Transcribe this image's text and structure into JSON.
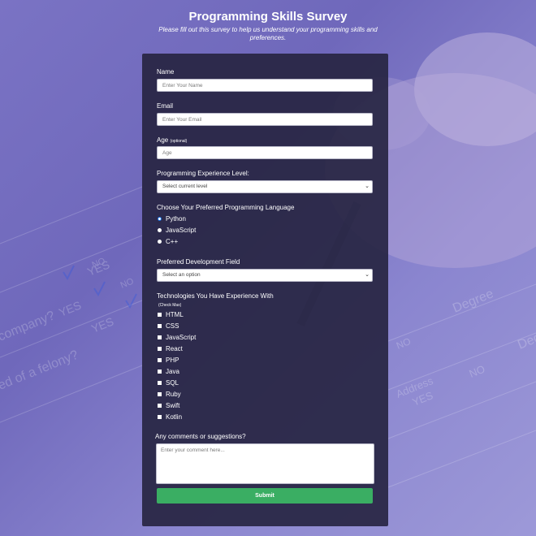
{
  "header": {
    "title": "Programming Skills Survey",
    "subtitle": "Please fill out this survey to help us understand your programming skills and preferences."
  },
  "form": {
    "name": {
      "label": "Name",
      "placeholder": "Enter Your Name"
    },
    "email": {
      "label": "Email",
      "placeholder": "Enter Your Email"
    },
    "age": {
      "label": "Age",
      "note": "(optional)",
      "placeholder": "Age"
    },
    "experience": {
      "label": "Programming Experience Level:",
      "selected": "Select current level"
    },
    "language": {
      "label": "Choose Your Preferred Programming Language",
      "options": [
        "Python",
        "JavaScript",
        "C++"
      ],
      "selected": "Python"
    },
    "field": {
      "label": "Preferred Development Field",
      "selected": "Select an option"
    },
    "technologies": {
      "label": "Technologies You Have Experience With",
      "note": "(Check Max)",
      "options": [
        "HTML",
        "CSS",
        "JavaScript",
        "React",
        "PHP",
        "Java",
        "SQL",
        "Ruby",
        "Swift",
        "Kotlin"
      ]
    },
    "comments": {
      "label": "Any comments or suggestions?",
      "placeholder": "Enter your comment here..."
    },
    "submit_label": "Submit"
  },
  "background_text": [
    "YES",
    "NO",
    "YES",
    "NO",
    "YES",
    "NO",
    "Degree",
    "Address",
    "company?",
    "ed of a felony?",
    "Address",
    "NO",
    "YES",
    "Degree",
    "Address"
  ],
  "colors": {
    "background": "#7a73c4",
    "card": "#272542",
    "submit": "#3aae63",
    "radio_checked": "#1a73e8"
  }
}
